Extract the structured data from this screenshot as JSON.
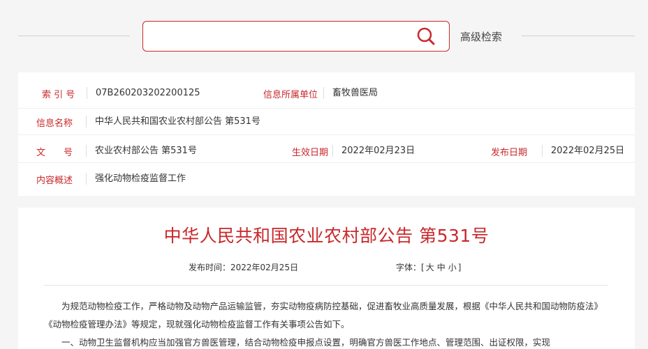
{
  "search": {
    "placeholder": "",
    "advanced_label": "高级检索"
  },
  "info": {
    "index_label": "索 引 号",
    "index_value": "07B260203202200125",
    "unit_label": "信息所属单位",
    "unit_value": "畜牧兽医局",
    "name_label": "信息名称",
    "name_value": "中华人民共和国农业农村部公告 第531号",
    "doc_label": "文　　号",
    "doc_value": "农业农村部公告 第531号",
    "effective_label": "生效日期",
    "effective_value": "2022年02月23日",
    "publish_label": "发布日期",
    "publish_value": "2022年02月25日",
    "summary_label": "内容概述",
    "summary_value": "强化动物检疫监督工作"
  },
  "article": {
    "title": "中华人民共和国农业农村部公告 第531号",
    "publish_time": "发布时间：2022年02月25日",
    "font_prefix": "字体：[",
    "font_large": "大",
    "font_medium": "中",
    "font_small": "小",
    "font_suffix": "]",
    "paragraphs": [
      "为规范动物检疫工作，严格动物及动物产品运输监管，夯实动物疫病防控基础，促进畜牧业高质量发展，根据《中华人民共和国动物防疫法》《动物检疫管理办法》等规定，现就强化动物检疫监督工作有关事项公告如下。",
      "一、动物卫生监督机构应当加强官方兽医管理，结合动物检疫申报点设置，明确官方兽医工作地点、管理范围、出证权限，实现"
    ]
  },
  "colors": {
    "accent": "#c9282b",
    "background": "#f5f5f5",
    "panel": "#ffffff"
  }
}
